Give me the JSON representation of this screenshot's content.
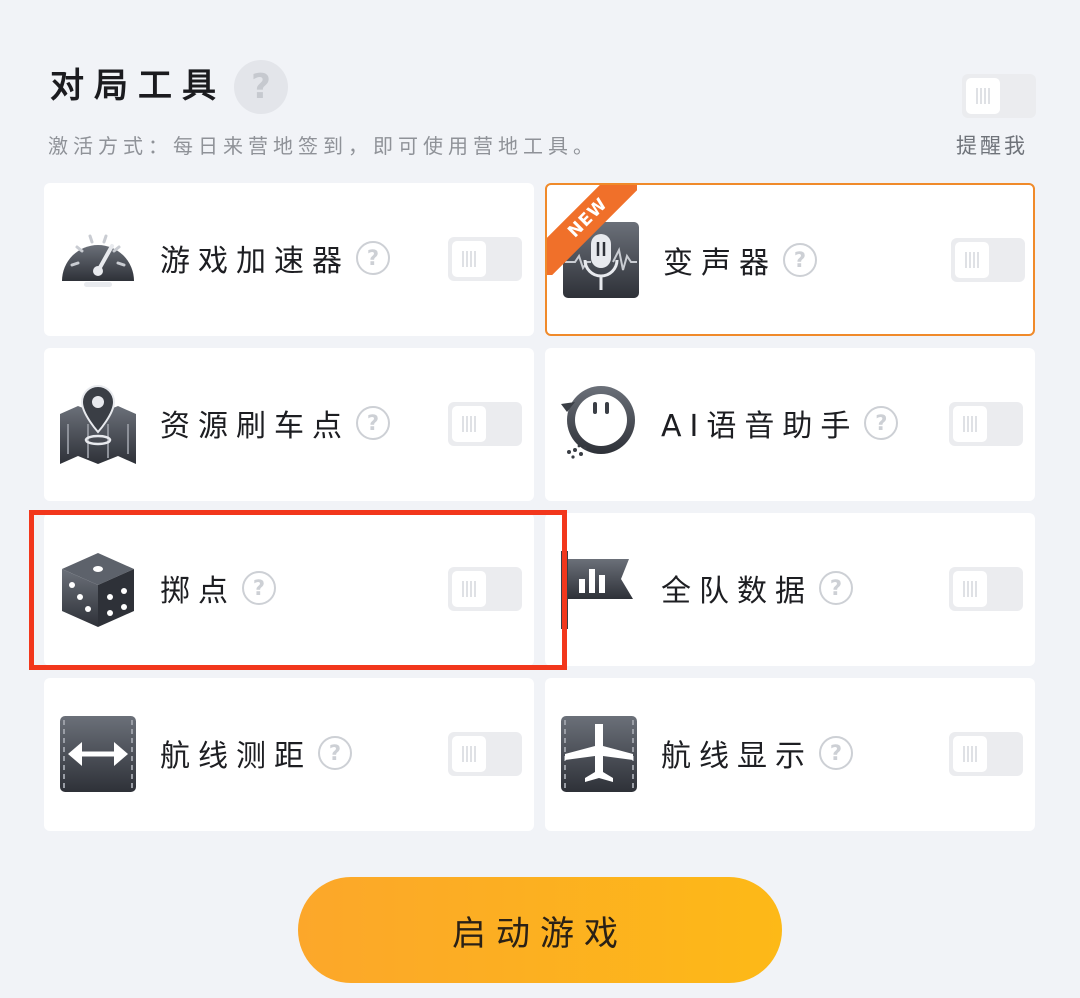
{
  "header": {
    "title": "对局工具",
    "help_symbol": "?",
    "subtitle": "激活方式：每日来营地签到，即可使用营地工具。",
    "remind_label": "提醒我"
  },
  "tools": [
    {
      "label": "游戏加速器",
      "icon": "speedometer-icon",
      "enabled": false,
      "badge": ""
    },
    {
      "label": "变声器",
      "icon": "voice-changer-icon",
      "enabled": false,
      "badge": "NEW"
    },
    {
      "label": "资源刷车点",
      "icon": "map-pin-icon",
      "enabled": false,
      "badge": ""
    },
    {
      "label": "AI语音助手",
      "icon": "chat-bubble-icon",
      "enabled": false,
      "badge": ""
    },
    {
      "label": "掷点",
      "icon": "dice-icon",
      "enabled": false,
      "badge": ""
    },
    {
      "label": "全队数据",
      "icon": "team-flag-icon",
      "enabled": false,
      "badge": ""
    },
    {
      "label": "航线测距",
      "icon": "measure-arrows-icon",
      "enabled": false,
      "badge": ""
    },
    {
      "label": "航线显示",
      "icon": "airplane-icon",
      "enabled": false,
      "badge": ""
    }
  ],
  "help_symbol": "?",
  "start_button_label": "启动游戏",
  "colors": {
    "accent_orange": "#fdb917",
    "highlight_border": "#f08a2a",
    "selection_red": "#f2371c",
    "new_badge": "#f0702a"
  }
}
